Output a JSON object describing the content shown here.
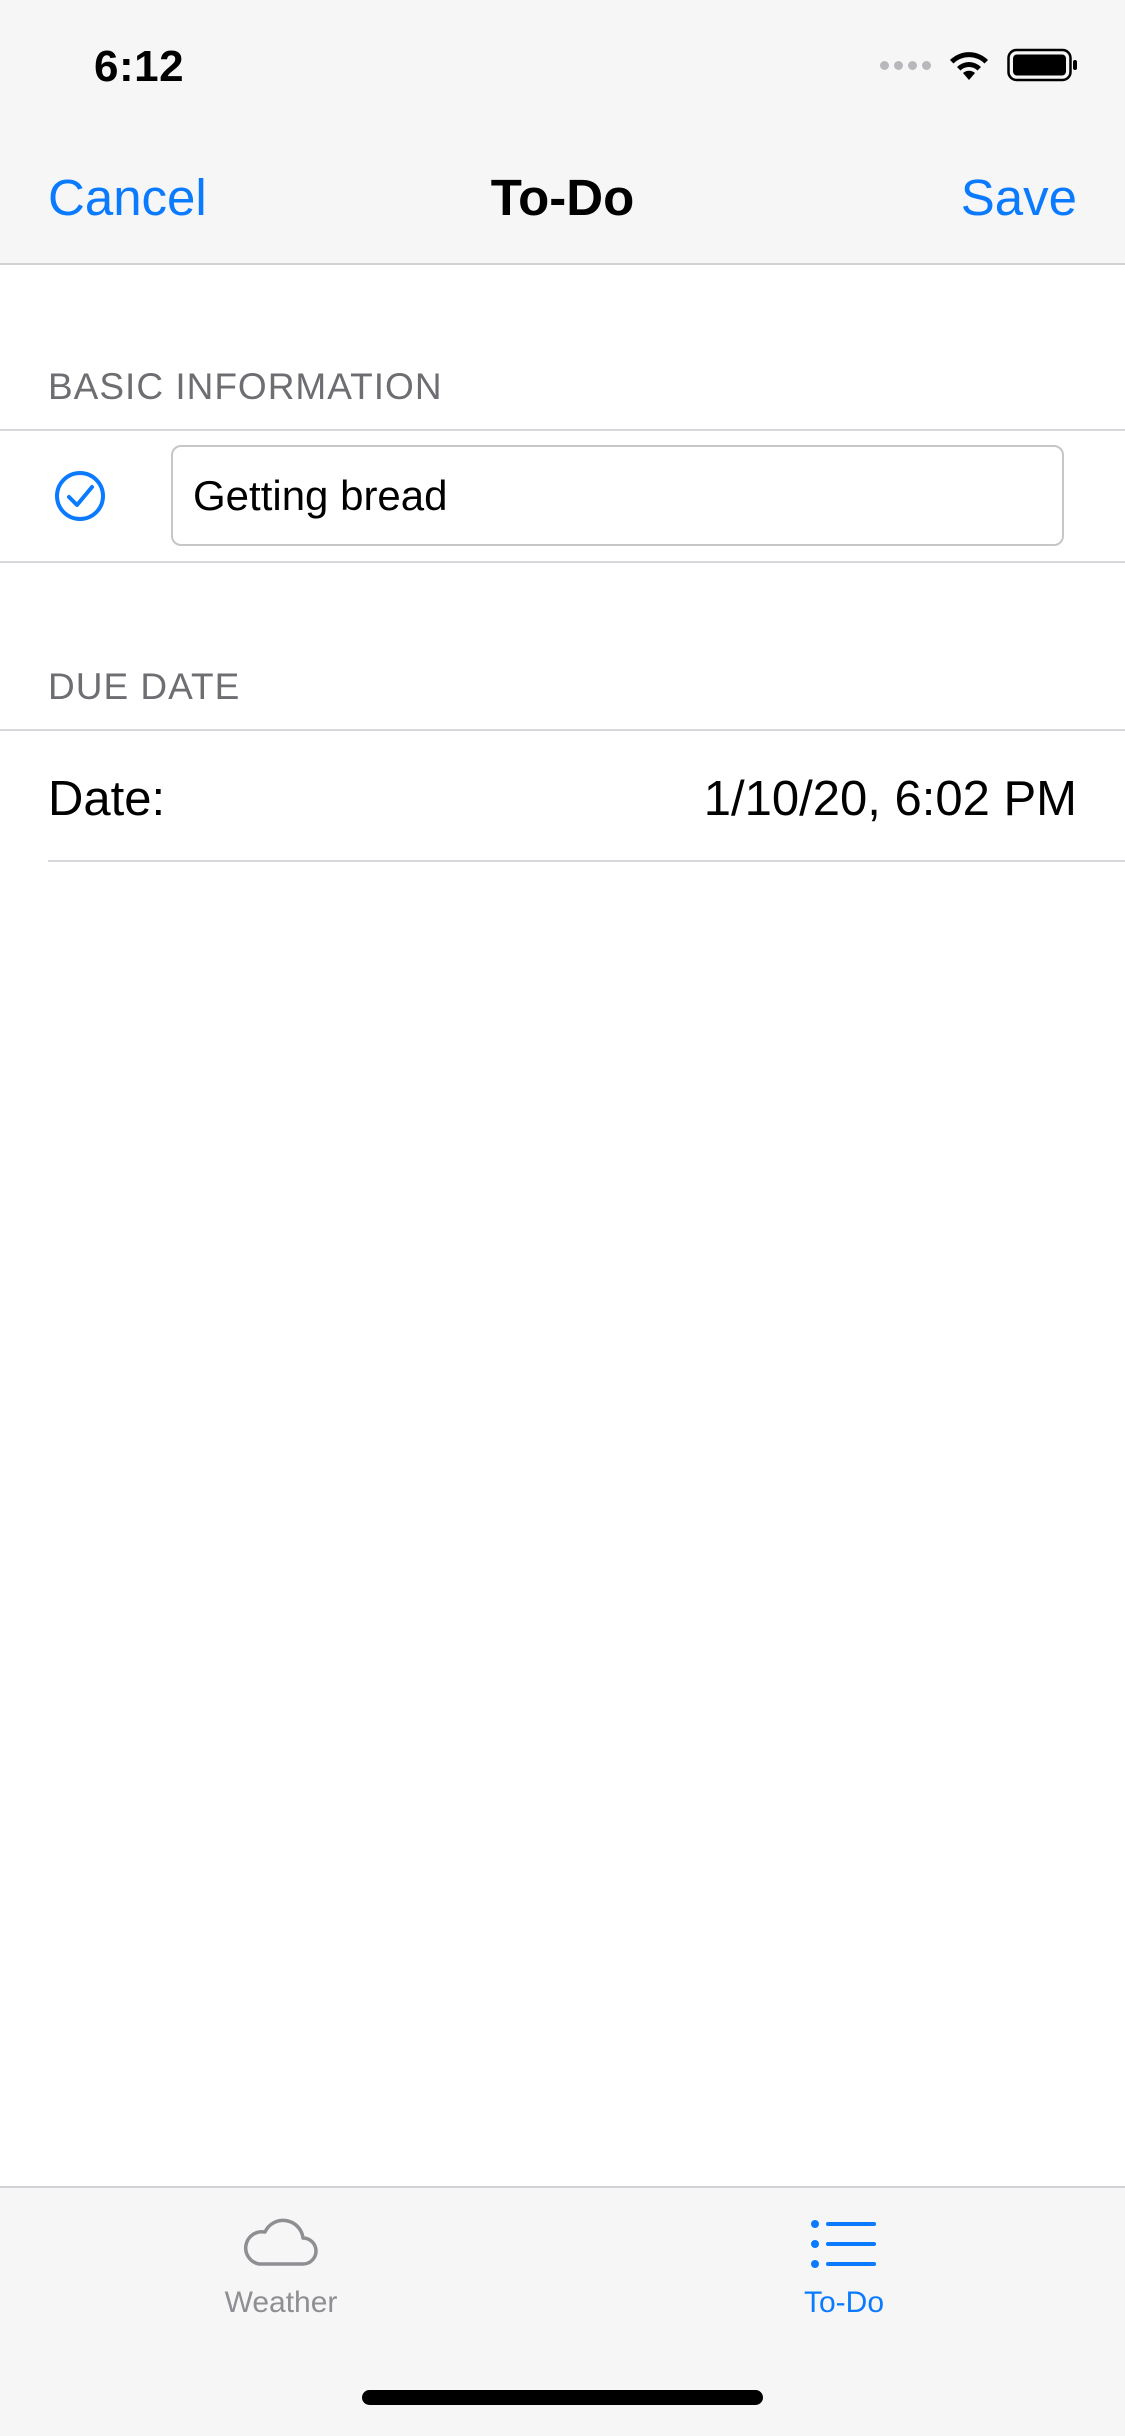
{
  "status_bar": {
    "time": "6:12"
  },
  "nav": {
    "cancel_label": "Cancel",
    "title": "To-Do",
    "save_label": "Save"
  },
  "basic_information": {
    "header": "BASIC INFORMATION",
    "todo_text": "Getting bread"
  },
  "due_date": {
    "header": "DUE DATE",
    "label": "Date:",
    "value": "1/10/20, 6:02 PM"
  },
  "tab_bar": {
    "tabs": [
      {
        "label": "Weather",
        "icon": "cloud-icon",
        "selected": false
      },
      {
        "label": "To-Do",
        "icon": "list-icon",
        "selected": true
      }
    ]
  },
  "colors": {
    "accent": "#0a7aff",
    "secondary_text": "#6d6d72",
    "inactive_tab": "#8e8e93"
  }
}
